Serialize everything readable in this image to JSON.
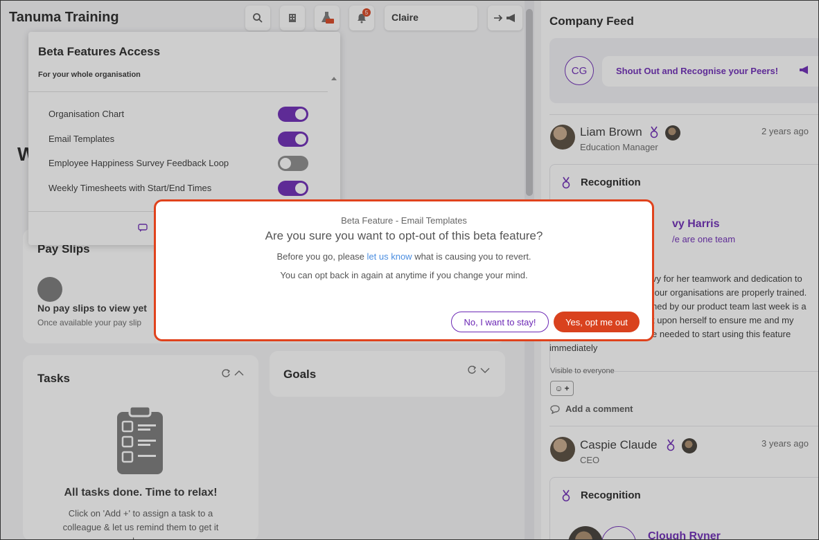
{
  "app": {
    "title": "Tanuma Training"
  },
  "topbar": {
    "user": "Claire",
    "notifications": "5"
  },
  "beta_panel": {
    "title": "Beta Features Access",
    "subtitle": "For your whole organisation",
    "items": [
      {
        "label": "Organisation Chart",
        "enabled": true
      },
      {
        "label": "Email Templates",
        "enabled": true
      },
      {
        "label": "Employee Happiness Survey Feedback Loop",
        "enabled": false
      },
      {
        "label": "Weekly Timesheets with Start/End Times",
        "enabled": true
      }
    ]
  },
  "left": {
    "payslips": {
      "title": "Pay Slips",
      "empty_title": "No pay slips to view yet",
      "empty_sub": "Once available your pay slip"
    },
    "tasks": {
      "title": "Tasks",
      "empty_title": "All tasks done. Time to relax!",
      "empty_sub": "Click on 'Add +' to assign a task to a colleague & let us remind them to get it done."
    },
    "goals": {
      "title": "Goals"
    },
    "partial_letter": "W"
  },
  "feed": {
    "title": "Company Feed",
    "avatar_initials": "CG",
    "shout_label": "Shout Out and Recognise your Peers!",
    "posts": [
      {
        "name": "Liam Brown",
        "role": "Education Manager",
        "time": "2 years ago",
        "type": "Recognition",
        "recipient": "vy Harris",
        "tagline": "/e are one team",
        "body": [
          "vy for her teamwork and dedication to",
          " our organisations are properly trained.",
          "hed by our product team last week is a",
          "t upon herself to ensure me and my",
          "e needed to start using this feature",
          "immediately"
        ],
        "visibility": "Visible to everyone",
        "comment_label": "Add a comment"
      },
      {
        "name": "Caspie Claude",
        "role": "CEO",
        "time": "3 years ago",
        "type": "Recognition",
        "recipient": "Clough Ryner"
      }
    ]
  },
  "modal": {
    "eyebrow": "Beta Feature - Email Templates",
    "title": "Are you sure you want to opt-out of this beta feature?",
    "line1_pre": "Before you go, please ",
    "line1_link": "let us know",
    "line1_post": " what is causing you to revert.",
    "line2": "You can opt back in again at anytime if you change your mind.",
    "stay_label": "No, I want to stay!",
    "optout_label": "Yes, opt me out"
  },
  "colors": {
    "accent": "#6a26b4",
    "danger": "#d9421e"
  }
}
